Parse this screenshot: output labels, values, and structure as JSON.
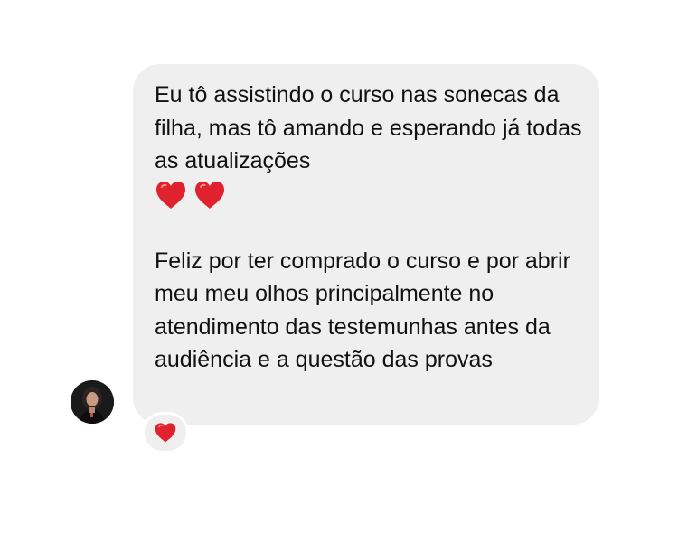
{
  "conversation": {
    "message": {
      "paragraph1": "Eu tô assistindo o curso nas sonecas da filha, mas tô amando e esperando já todas as atualizações",
      "emoji_line": [
        "red-heart",
        "red-heart"
      ],
      "paragraph2": "Feliz por ter comprado o curso e por abrir meu meu olhos principalmente no atendimento das testemunhas antes da audiência e a questão das provas"
    },
    "reaction": "red-heart"
  },
  "colors": {
    "bubble_bg": "#efefef",
    "text": "#111111",
    "heart": "#e0222f",
    "background": "#ffffff"
  }
}
